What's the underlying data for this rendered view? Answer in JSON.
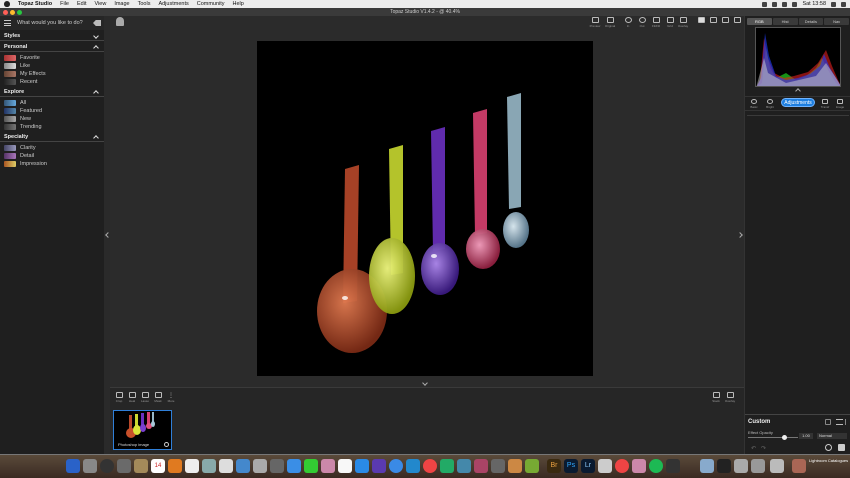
{
  "menubar": {
    "app": "Topaz Studio",
    "items": [
      "File",
      "Edit",
      "View",
      "Image",
      "Tools",
      "Adjustments",
      "Community",
      "Help"
    ],
    "clock": "Sat 13:58"
  },
  "window": {
    "title": "Topaz Studio V1.4.2 - @ 40.4%"
  },
  "left_panel": {
    "search_placeholder": "What would you like to do?",
    "sections": [
      {
        "title": "Styles",
        "items": []
      },
      {
        "title": "Personal",
        "items": [
          "Favorite",
          "Like",
          "My Effects",
          "Recent"
        ]
      },
      {
        "title": "Explore",
        "items": [
          "All",
          "Featured",
          "New",
          "Trending"
        ]
      },
      {
        "title": "Specialty",
        "items": [
          "Clarity",
          "Detail",
          "Impression"
        ]
      }
    ]
  },
  "toolbar": {
    "labels": [
      "Preview",
      "Original",
      "In",
      "Out",
      "Fit/Fill",
      "Grid",
      "Overlay"
    ]
  },
  "filmstrip": {
    "tools": [
      "Crop",
      "Heal",
      "Lasso",
      "Mask",
      "More"
    ],
    "right_tools": [
      "Stack",
      "Overlay"
    ],
    "thumbnail_caption": "Photoshop image"
  },
  "right_panel": {
    "tabs": [
      "RGB",
      "Hist",
      "Details",
      "Nav"
    ],
    "active_tab": "RGB",
    "tools": [
      "Basic",
      "Bright",
      "Adjustments",
      "Transf",
      "Image"
    ],
    "active_tool": "Adjustments",
    "custom": {
      "title": "Custom",
      "effect_opacity_label": "Effect Opacity",
      "effect_opacity_value": "1.00",
      "blend_mode": "Normal"
    }
  },
  "dock": {
    "calendar_day": "14",
    "label": "Lightroom Catalogues"
  },
  "colors": {
    "accent": "#1e7fe0",
    "spoons": [
      "#c8502a",
      "#d9e63a",
      "#7a3fd0",
      "#e0507a",
      "#a8c8d8"
    ]
  }
}
